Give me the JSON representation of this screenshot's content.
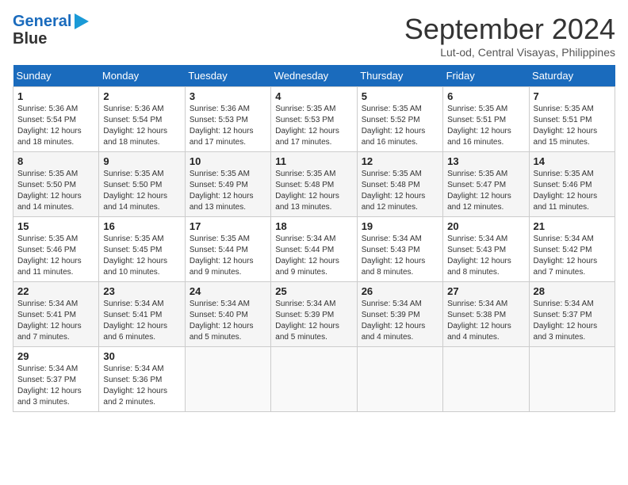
{
  "header": {
    "logo_line1": "General",
    "logo_line2": "Blue",
    "month": "September 2024",
    "location": "Lut-od, Central Visayas, Philippines"
  },
  "calendar": {
    "days_of_week": [
      "Sunday",
      "Monday",
      "Tuesday",
      "Wednesday",
      "Thursday",
      "Friday",
      "Saturday"
    ],
    "weeks": [
      [
        {
          "day": "",
          "info": ""
        },
        {
          "day": "2",
          "info": "Sunrise: 5:36 AM\nSunset: 5:54 PM\nDaylight: 12 hours\nand 18 minutes."
        },
        {
          "day": "3",
          "info": "Sunrise: 5:36 AM\nSunset: 5:53 PM\nDaylight: 12 hours\nand 17 minutes."
        },
        {
          "day": "4",
          "info": "Sunrise: 5:35 AM\nSunset: 5:53 PM\nDaylight: 12 hours\nand 17 minutes."
        },
        {
          "day": "5",
          "info": "Sunrise: 5:35 AM\nSunset: 5:52 PM\nDaylight: 12 hours\nand 16 minutes."
        },
        {
          "day": "6",
          "info": "Sunrise: 5:35 AM\nSunset: 5:51 PM\nDaylight: 12 hours\nand 16 minutes."
        },
        {
          "day": "7",
          "info": "Sunrise: 5:35 AM\nSunset: 5:51 PM\nDaylight: 12 hours\nand 15 minutes."
        }
      ],
      [
        {
          "day": "1",
          "info": "Sunrise: 5:36 AM\nSunset: 5:54 PM\nDaylight: 12 hours\nand 18 minutes."
        },
        {
          "day": "",
          "info": ""
        },
        {
          "day": "",
          "info": ""
        },
        {
          "day": "",
          "info": ""
        },
        {
          "day": "",
          "info": ""
        },
        {
          "day": "",
          "info": ""
        },
        {
          "day": "",
          "info": ""
        }
      ],
      [
        {
          "day": "8",
          "info": "Sunrise: 5:35 AM\nSunset: 5:50 PM\nDaylight: 12 hours\nand 14 minutes."
        },
        {
          "day": "9",
          "info": "Sunrise: 5:35 AM\nSunset: 5:50 PM\nDaylight: 12 hours\nand 14 minutes."
        },
        {
          "day": "10",
          "info": "Sunrise: 5:35 AM\nSunset: 5:49 PM\nDaylight: 12 hours\nand 13 minutes."
        },
        {
          "day": "11",
          "info": "Sunrise: 5:35 AM\nSunset: 5:48 PM\nDaylight: 12 hours\nand 13 minutes."
        },
        {
          "day": "12",
          "info": "Sunrise: 5:35 AM\nSunset: 5:48 PM\nDaylight: 12 hours\nand 12 minutes."
        },
        {
          "day": "13",
          "info": "Sunrise: 5:35 AM\nSunset: 5:47 PM\nDaylight: 12 hours\nand 12 minutes."
        },
        {
          "day": "14",
          "info": "Sunrise: 5:35 AM\nSunset: 5:46 PM\nDaylight: 12 hours\nand 11 minutes."
        }
      ],
      [
        {
          "day": "15",
          "info": "Sunrise: 5:35 AM\nSunset: 5:46 PM\nDaylight: 12 hours\nand 11 minutes."
        },
        {
          "day": "16",
          "info": "Sunrise: 5:35 AM\nSunset: 5:45 PM\nDaylight: 12 hours\nand 10 minutes."
        },
        {
          "day": "17",
          "info": "Sunrise: 5:35 AM\nSunset: 5:44 PM\nDaylight: 12 hours\nand 9 minutes."
        },
        {
          "day": "18",
          "info": "Sunrise: 5:34 AM\nSunset: 5:44 PM\nDaylight: 12 hours\nand 9 minutes."
        },
        {
          "day": "19",
          "info": "Sunrise: 5:34 AM\nSunset: 5:43 PM\nDaylight: 12 hours\nand 8 minutes."
        },
        {
          "day": "20",
          "info": "Sunrise: 5:34 AM\nSunset: 5:43 PM\nDaylight: 12 hours\nand 8 minutes."
        },
        {
          "day": "21",
          "info": "Sunrise: 5:34 AM\nSunset: 5:42 PM\nDaylight: 12 hours\nand 7 minutes."
        }
      ],
      [
        {
          "day": "22",
          "info": "Sunrise: 5:34 AM\nSunset: 5:41 PM\nDaylight: 12 hours\nand 7 minutes."
        },
        {
          "day": "23",
          "info": "Sunrise: 5:34 AM\nSunset: 5:41 PM\nDaylight: 12 hours\nand 6 minutes."
        },
        {
          "day": "24",
          "info": "Sunrise: 5:34 AM\nSunset: 5:40 PM\nDaylight: 12 hours\nand 5 minutes."
        },
        {
          "day": "25",
          "info": "Sunrise: 5:34 AM\nSunset: 5:39 PM\nDaylight: 12 hours\nand 5 minutes."
        },
        {
          "day": "26",
          "info": "Sunrise: 5:34 AM\nSunset: 5:39 PM\nDaylight: 12 hours\nand 4 minutes."
        },
        {
          "day": "27",
          "info": "Sunrise: 5:34 AM\nSunset: 5:38 PM\nDaylight: 12 hours\nand 4 minutes."
        },
        {
          "day": "28",
          "info": "Sunrise: 5:34 AM\nSunset: 5:37 PM\nDaylight: 12 hours\nand 3 minutes."
        }
      ],
      [
        {
          "day": "29",
          "info": "Sunrise: 5:34 AM\nSunset: 5:37 PM\nDaylight: 12 hours\nand 3 minutes."
        },
        {
          "day": "30",
          "info": "Sunrise: 5:34 AM\nSunset: 5:36 PM\nDaylight: 12 hours\nand 2 minutes."
        },
        {
          "day": "",
          "info": ""
        },
        {
          "day": "",
          "info": ""
        },
        {
          "day": "",
          "info": ""
        },
        {
          "day": "",
          "info": ""
        },
        {
          "day": "",
          "info": ""
        }
      ]
    ]
  }
}
